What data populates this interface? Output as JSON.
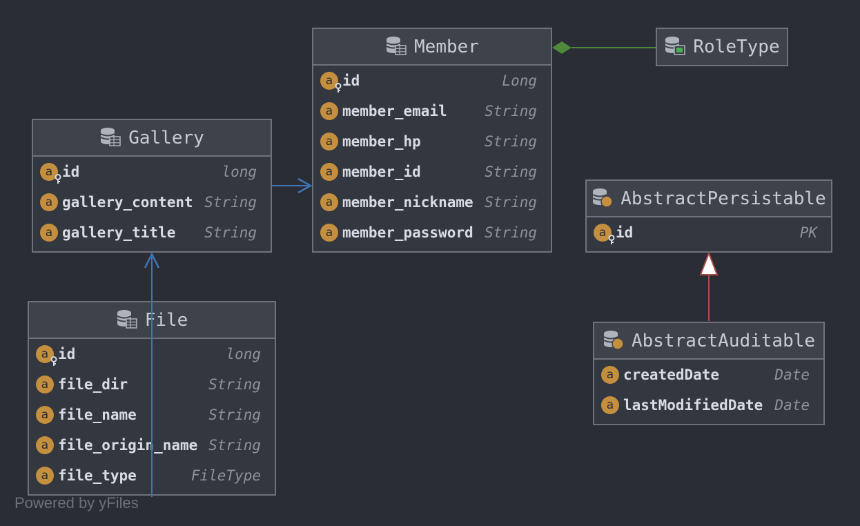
{
  "colors": {
    "background": "#2b2d35",
    "header": "#3d424b",
    "border": "#6e737b",
    "field_icon": "#c48f3e",
    "association_edge": "#3d75b8",
    "composition_edge": "#4f8a3c",
    "inheritance_edge": "#b04a4a"
  },
  "nodes": {
    "member": {
      "title": "Member",
      "icon": "entity-table-icon",
      "fields": [
        {
          "name": "id",
          "type": "Long",
          "key": true
        },
        {
          "name": "member_email",
          "type": "String"
        },
        {
          "name": "member_hp",
          "type": "String"
        },
        {
          "name": "member_id",
          "type": "String"
        },
        {
          "name": "member_nickname",
          "type": "String"
        },
        {
          "name": "member_password",
          "type": "String"
        }
      ]
    },
    "roletype": {
      "title": "RoleType",
      "icon": "enum-table-icon"
    },
    "gallery": {
      "title": "Gallery",
      "icon": "entity-table-icon",
      "fields": [
        {
          "name": "id",
          "type": "long",
          "key": true
        },
        {
          "name": "gallery_content",
          "type": "String"
        },
        {
          "name": "gallery_title",
          "type": "String"
        }
      ]
    },
    "abstract_persistable": {
      "title": "AbstractPersistable",
      "icon": "mapped-superclass-icon",
      "fields": [
        {
          "name": "id",
          "type": "PK",
          "key": true
        }
      ]
    },
    "file": {
      "title": "File",
      "icon": "entity-table-icon",
      "fields": [
        {
          "name": "id",
          "type": "long",
          "key": true
        },
        {
          "name": "file_dir",
          "type": "String"
        },
        {
          "name": "file_name",
          "type": "String"
        },
        {
          "name": "file_origin_name",
          "type": "String"
        },
        {
          "name": "file_type",
          "type": "FileType"
        }
      ]
    },
    "abstract_auditable": {
      "title": "AbstractAuditable",
      "icon": "mapped-superclass-icon",
      "fields": [
        {
          "name": "createdDate",
          "type": "Date"
        },
        {
          "name": "lastModifiedDate",
          "type": "Date"
        }
      ]
    }
  },
  "field_icon_letter": "a",
  "footer": {
    "powered_by": "Powered by yFiles"
  }
}
